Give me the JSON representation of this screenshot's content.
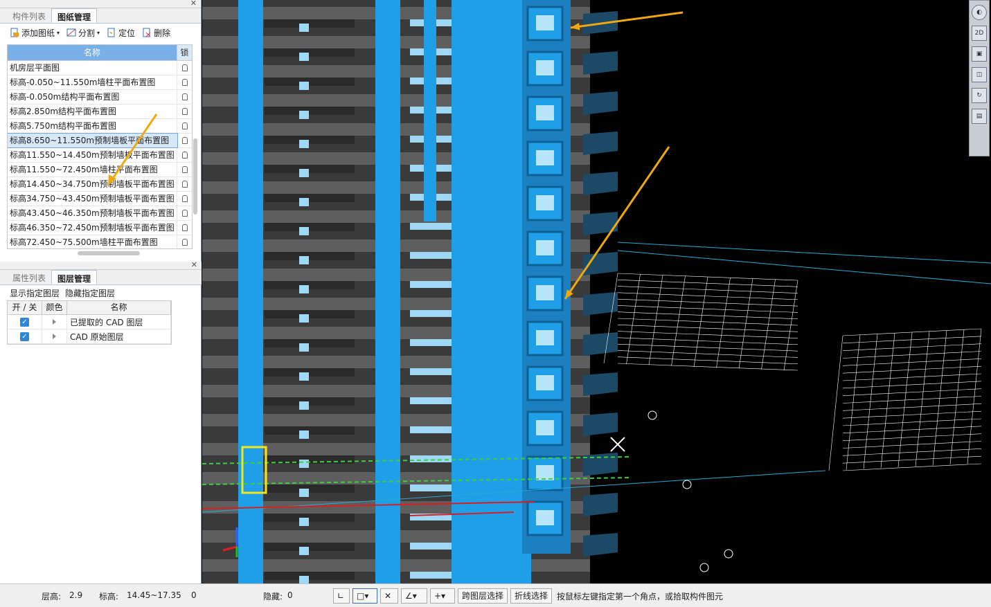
{
  "drawing_panel": {
    "tabs": [
      "构件列表",
      "图纸管理"
    ],
    "active_tab": "图纸管理",
    "toolbar": {
      "add_label": "添加图纸",
      "split_label": "分割",
      "locate_label": "定位",
      "delete_label": "删除"
    },
    "columns": {
      "name": "名称",
      "lock": "锁"
    },
    "rows": [
      "机房层平面图",
      "标高-0.050~11.550m墙柱平面布置图",
      "标高-0.050m结构平面布置图",
      "标高2.850m结构平面布置图",
      "标高5.750m结构平面布置图",
      "标高8.650~11.550m预制墙板平面布置图",
      "标高11.550~14.450m预制墙板平面布置图",
      "标高11.550~72.450m墙柱平面布置图",
      "标高14.450~34.750m预制墙板平面布置图",
      "标高34.750~43.450m预制墙板平面布置图",
      "标高43.450~46.350m预制墙板平面布置图",
      "标高46.350~72.450m预制墙板平面布置图",
      "标高72.450~75.500m墙柱平面布置图"
    ],
    "selected_row": "标高8.650~11.550m预制墙板平面布置图"
  },
  "layer_panel": {
    "tabs": [
      "属性列表",
      "图层管理"
    ],
    "active_tab": "图层管理",
    "show_label": "显示指定图层",
    "hide_label": "隐藏指定图层",
    "columns": {
      "onoff": "开 / 关",
      "color": "颜色",
      "name": "名称"
    },
    "rows": [
      {
        "checked": true,
        "name": "已提取的 CAD 图层"
      },
      {
        "checked": true,
        "name": "CAD 原始图层"
      }
    ]
  },
  "view_tools": {
    "mode_2d": "2D"
  },
  "status_bar": {
    "floor_height_label": "层高:",
    "floor_height_value": "2.9",
    "elevation_label": "标高:",
    "elevation_value": "14.45~17.35",
    "count_value": "0",
    "hidden_label": "隐藏:",
    "hidden_value": "0",
    "cross_layer_label": "跨图层选择",
    "polyline_label": "折线选择",
    "hint": "按鼠标左键指定第一个角点，或拾取构件图元"
  },
  "colors": {
    "accent_blue": "#1e9fe8",
    "slab_gray": "#555555",
    "arrow_orange": "#f0a810",
    "cad_white": "#ffffff"
  }
}
